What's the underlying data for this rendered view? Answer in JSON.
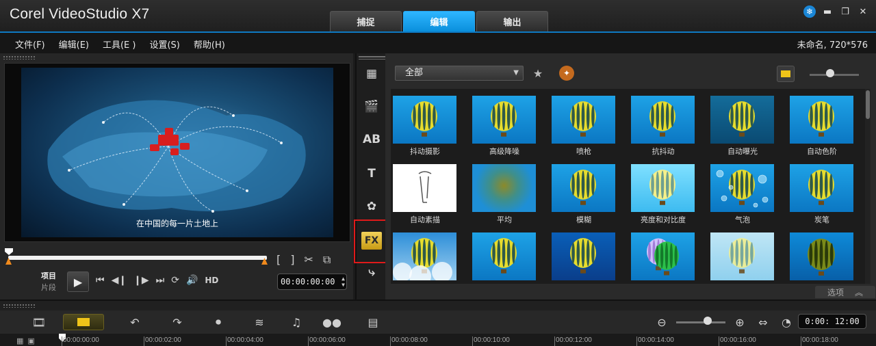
{
  "app": {
    "title": "Corel VideoStudio X7"
  },
  "tabs": [
    {
      "label": "捕捉",
      "active": false
    },
    {
      "label": "编辑",
      "active": true
    },
    {
      "label": "输出",
      "active": false
    }
  ],
  "window_controls": {
    "minimize": "▬",
    "restore": "❐",
    "close": "✕",
    "snow": "❄"
  },
  "menu": [
    {
      "label": "文件(F)"
    },
    {
      "label": "编辑(E)"
    },
    {
      "label": "工具(E )"
    },
    {
      "label": "设置(S)"
    },
    {
      "label": "帮助(H)"
    }
  ],
  "project_info": "未命名, 720*576",
  "preview": {
    "caption": "在中国的每一片土地上",
    "mode_project": "项目",
    "mode_clip": "片段",
    "timecode": "00:00:00:00",
    "hd": "HD",
    "mark_in": "[",
    "mark_out": "]"
  },
  "library": {
    "category": "全部",
    "options_label": "选项",
    "filters": [
      {
        "label": "抖动摄影",
        "style": "balloon"
      },
      {
        "label": "高级降噪",
        "style": "balloon"
      },
      {
        "label": "喷枪",
        "style": "balloon"
      },
      {
        "label": "抗抖动",
        "style": "balloon"
      },
      {
        "label": "自动曝光",
        "style": "dark"
      },
      {
        "label": "自动色阶",
        "style": "balloon"
      },
      {
        "label": "自动素描",
        "style": "sketch"
      },
      {
        "label": "平均",
        "style": "blur"
      },
      {
        "label": "模糊",
        "style": "balloon"
      },
      {
        "label": "亮度和对比度",
        "style": "bright"
      },
      {
        "label": "气泡",
        "style": "bubble"
      },
      {
        "label": "炭笔",
        "style": "balloon"
      },
      {
        "label": "",
        "style": "clouds"
      },
      {
        "label": "",
        "style": "balloon"
      },
      {
        "label": "",
        "style": "deep"
      },
      {
        "label": "",
        "style": "double"
      },
      {
        "label": "",
        "style": "pale"
      },
      {
        "label": "",
        "style": "texture"
      }
    ]
  },
  "timeline": {
    "timecode": "0:00: 12:00",
    "ruler": [
      "00:00:00:00",
      "00:00:02:00",
      "00:00:04:00",
      "00:00:06:00",
      "00:00:08:00",
      "00:00:10:00",
      "00:00:12:00",
      "00:00:14:00",
      "00:00:16:00",
      "00:00:18:00"
    ]
  },
  "colors": {
    "accent": "#0a8fdc",
    "highlight": "#e01a1a",
    "fx_gold": "#f0c419"
  }
}
